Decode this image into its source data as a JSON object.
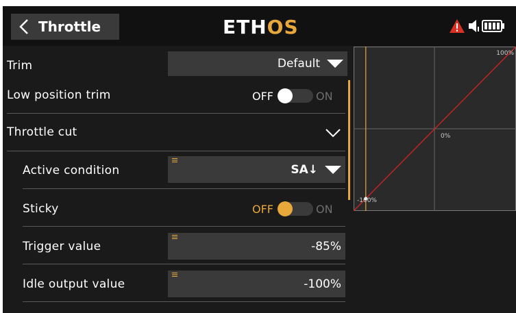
{
  "header": {
    "title": "Throttle",
    "brand_main": "ETH",
    "brand_accent": "OS"
  },
  "rows": {
    "trim": {
      "label": "Trim",
      "value": "Default"
    },
    "low_position_trim": {
      "label": "Low position trim",
      "off": "OFF",
      "on": "ON",
      "state": "off"
    },
    "throttle_cut": {
      "label": "Throttle cut"
    },
    "active_condition": {
      "label": "Active condition",
      "value": "SA↓"
    },
    "sticky": {
      "label": "Sticky",
      "off": "OFF",
      "on": "ON",
      "state": "off"
    },
    "trigger_value": {
      "label": "Trigger value",
      "value": "-85%"
    },
    "idle_output_value": {
      "label": "Idle output value",
      "value": "-100%"
    }
  },
  "graph": {
    "label_top_right": "100%",
    "label_center": "0%",
    "label_bottom_left": "-100%",
    "trigger_x_percent": -85,
    "line_color": "#cc2222",
    "marker_color": "#e8a83a"
  },
  "colors": {
    "accent": "#e8a83a",
    "warning": "#d93025"
  }
}
